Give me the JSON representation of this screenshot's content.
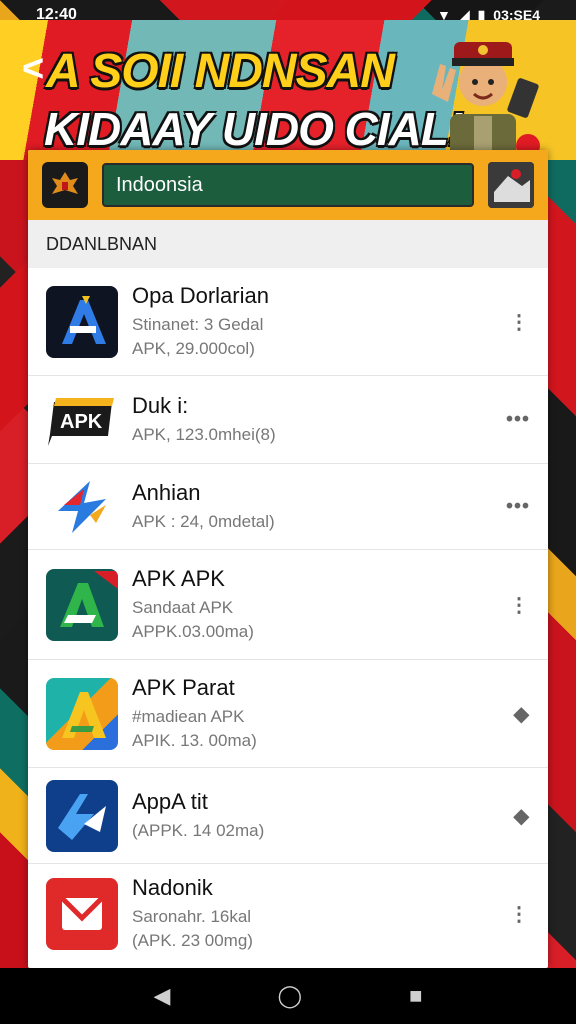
{
  "status_bar": {
    "time": "12:40",
    "right": "03:SE4"
  },
  "banner": {
    "line1": "A SOII NDNSAN",
    "line2": "KIDAAY UIDO CIAL!",
    "back_icon": "back-arrow-icon"
  },
  "header": {
    "search_value": "Indoonsia",
    "accent_color": "#f6a81d",
    "field_color": "#1b5d3d"
  },
  "section_title": "DDANLBNAN",
  "apps": [
    {
      "name": "Opa Dorlarian",
      "line1": "Stinanet: 3 Gedal",
      "line2": "APK, 29.000col)",
      "more": "⋮",
      "icon": "a-letter-blue-icon"
    },
    {
      "name": "Duk i:",
      "line1": "APK, 123.0mhei(8)",
      "line2": "",
      "more": "•••",
      "icon": "apk-badge-icon"
    },
    {
      "name": "Anhian",
      "line1": "APK : 24, 0mdetal)",
      "line2": "",
      "more": "•••",
      "icon": "arrow-star-icon"
    },
    {
      "name": "APK APK",
      "line1": "Sandaat APK",
      "line2": "APPK.03.00ma)",
      "more": "⋮",
      "icon": "green-a-icon"
    },
    {
      "name": "APK Parat",
      "line1": "#madiean APK",
      "line2": "APIK. 13. 00ma)",
      "more": "◆",
      "icon": "colorful-a-icon"
    },
    {
      "name": "AppA tit",
      "line1": "(APPK. 14 02ma)",
      "line2": "",
      "more": "◆",
      "icon": "blue-arrows-icon"
    },
    {
      "name": "Nadonik",
      "line1": "Saronahr. 16kal",
      "line2": "(APK. 23 00mg)",
      "more": "⋮",
      "icon": "red-mail-icon"
    }
  ],
  "nav": {
    "back": "◀",
    "home": "◯",
    "recents": "■"
  }
}
